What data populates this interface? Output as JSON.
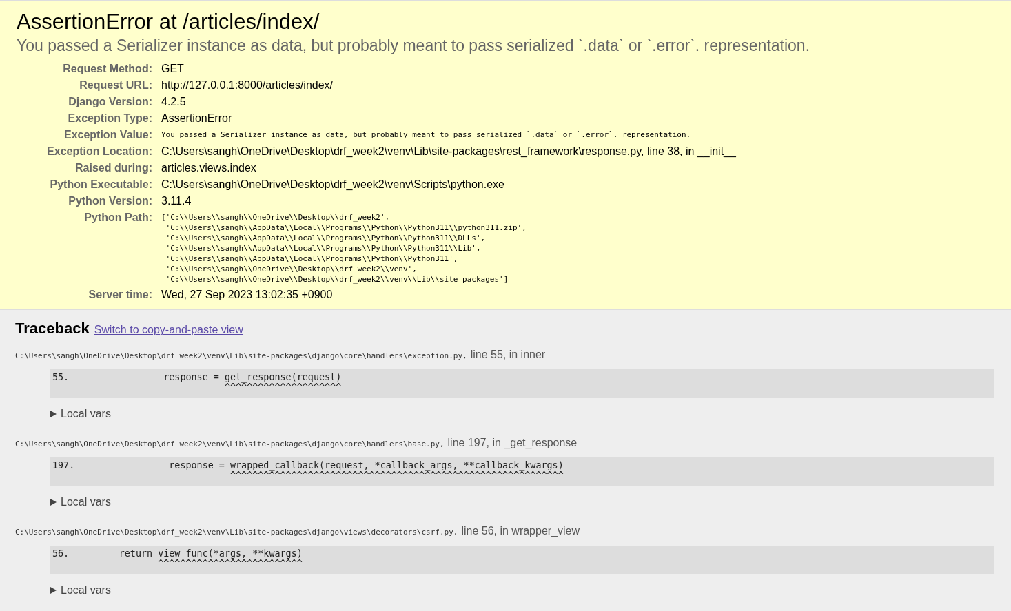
{
  "summary": {
    "title": "AssertionError at /articles/index/",
    "message": "You passed a Serializer instance as data, but probably meant to pass serialized `.data` or `.error`. representation.",
    "meta": [
      {
        "label": "Request Method:",
        "kind": "text",
        "value": "GET"
      },
      {
        "label": "Request URL:",
        "kind": "text",
        "value": "http://127.0.0.1:8000/articles/index/"
      },
      {
        "label": "Django Version:",
        "kind": "text",
        "value": "4.2.5"
      },
      {
        "label": "Exception Type:",
        "kind": "text",
        "value": "AssertionError"
      },
      {
        "label": "Exception Value:",
        "kind": "mono",
        "value": "You passed a Serializer instance as data, but probably meant to pass serialized `.data` or `.error`. representation."
      },
      {
        "label": "Exception Location:",
        "kind": "text",
        "value": "C:\\Users\\sangh\\OneDrive\\Desktop\\drf_week2\\venv\\Lib\\site-packages\\rest_framework\\response.py, line 38, in __init__"
      },
      {
        "label": "Raised during:",
        "kind": "text",
        "value": "articles.views.index"
      },
      {
        "label": "Python Executable:",
        "kind": "text",
        "value": "C:\\Users\\sangh\\OneDrive\\Desktop\\drf_week2\\venv\\Scripts\\python.exe"
      },
      {
        "label": "Python Version:",
        "kind": "text",
        "value": "3.11.4"
      },
      {
        "label": "Python Path:",
        "kind": "mono",
        "value": "['C:\\\\Users\\\\sangh\\\\OneDrive\\\\Desktop\\\\drf_week2',\n 'C:\\\\Users\\\\sangh\\\\AppData\\\\Local\\\\Programs\\\\Python\\\\Python311\\\\python311.zip',\n 'C:\\\\Users\\\\sangh\\\\AppData\\\\Local\\\\Programs\\\\Python\\\\Python311\\\\DLLs',\n 'C:\\\\Users\\\\sangh\\\\AppData\\\\Local\\\\Programs\\\\Python\\\\Python311\\\\Lib',\n 'C:\\\\Users\\\\sangh\\\\AppData\\\\Local\\\\Programs\\\\Python\\\\Python311',\n 'C:\\\\Users\\\\sangh\\\\OneDrive\\\\Desktop\\\\drf_week2\\\\venv',\n 'C:\\\\Users\\\\sangh\\\\OneDrive\\\\Desktop\\\\drf_week2\\\\venv\\\\Lib\\\\site-packages']"
      },
      {
        "label": "Server time:",
        "kind": "text",
        "value": "Wed, 27 Sep 2023 13:02:35 +0900"
      }
    ]
  },
  "traceback": {
    "title": "Traceback",
    "switch_link": "Switch to copy-and-paste view",
    "frames": [
      {
        "file": "C:\\Users\\sangh\\OneDrive\\Desktop\\drf_week2\\venv\\Lib\\site-packages\\django\\core\\handlers\\exception.py,",
        "location": "line 55, in inner",
        "line_number": "55.",
        "code": "                response = get_response(request)",
        "carets": "                               ^^^^^^^^^^^^^^^^^^^^^",
        "local_vars": "Local vars"
      },
      {
        "file": "C:\\Users\\sangh\\OneDrive\\Desktop\\drf_week2\\venv\\Lib\\site-packages\\django\\core\\handlers\\base.py,",
        "location": "line 197, in _get_response",
        "line_number": "197.",
        "code": "                response = wrapped_callback(request, *callback_args, **callback_kwargs)",
        "carets": "                                ^^^^^^^^^^^^^^^^^^^^^^^^^^^^^^^^^^^^^^^^^^^^^^^^^^^^^^^^^^^^",
        "local_vars": "Local vars"
      },
      {
        "file": "C:\\Users\\sangh\\OneDrive\\Desktop\\drf_week2\\venv\\Lib\\site-packages\\django\\views\\decorators\\csrf.py,",
        "location": "line 56, in wrapper_view",
        "line_number": "56.",
        "code": "        return view_func(*args, **kwargs)",
        "carets": "                   ^^^^^^^^^^^^^^^^^^^^^^^^^^",
        "local_vars": "Local vars"
      }
    ]
  }
}
